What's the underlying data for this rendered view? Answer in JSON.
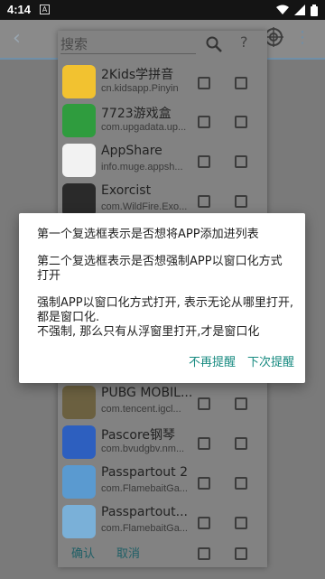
{
  "status_bar": {
    "time": "4:14",
    "notification_glyph": "A"
  },
  "sheet": {
    "search_placeholder": "搜索",
    "help_label": "?",
    "apps": [
      {
        "name": "2Kids学拼音",
        "package": "cn.kidsapp.Pinyin",
        "icon": "pinyin-app-icon",
        "color": "#f2c230"
      },
      {
        "name": "7723游戏盒",
        "package": "com.upgadata.up...",
        "icon": "game-box-app-icon",
        "color": "#2f9c3e"
      },
      {
        "name": "AppShare",
        "package": "info.muge.appsh...",
        "icon": "appshare-app-icon",
        "color": "#f2f2f2"
      },
      {
        "name": "Exorcist",
        "package": "com.WildFire.Exo...",
        "icon": "exorcist-app-icon",
        "color": "#2a2a2a"
      },
      {
        "name": "PUBG MOBIL...",
        "package": "com.tencent.igcl...",
        "icon": "pubg-app-icon",
        "color": "#6b6040"
      },
      {
        "name": "Pascore钢琴",
        "package": "com.bvudgbv.nm...",
        "icon": "pascore-app-icon",
        "color": "#2d5fbf"
      },
      {
        "name": "Passpartout 2",
        "package": "com.FlamebaitGa...",
        "icon": "passpartout2-app-icon",
        "color": "#5a9ad0"
      },
      {
        "name": "Passpartout...",
        "package": "com.FlamebaitGa...",
        "icon": "passpartout-app-icon",
        "color": "#7ab0d8"
      }
    ],
    "ok_label": "确认",
    "cancel_label": "取消"
  },
  "dialog": {
    "line1": "第一个复选框表示是否想将APP添加进列表",
    "line2": "第二个复选框表示是否想强制APP以窗口化方式打开",
    "line3": "强制APP以窗口化方式打开, 表示无论从哪里打开, 都是窗口化.",
    "line4": "不强制, 那么只有从浮窗里打开,才是窗口化",
    "never_remind_label": "不再提醒",
    "next_remind_label": "下次提醒",
    "accent_color": "#178a80"
  }
}
